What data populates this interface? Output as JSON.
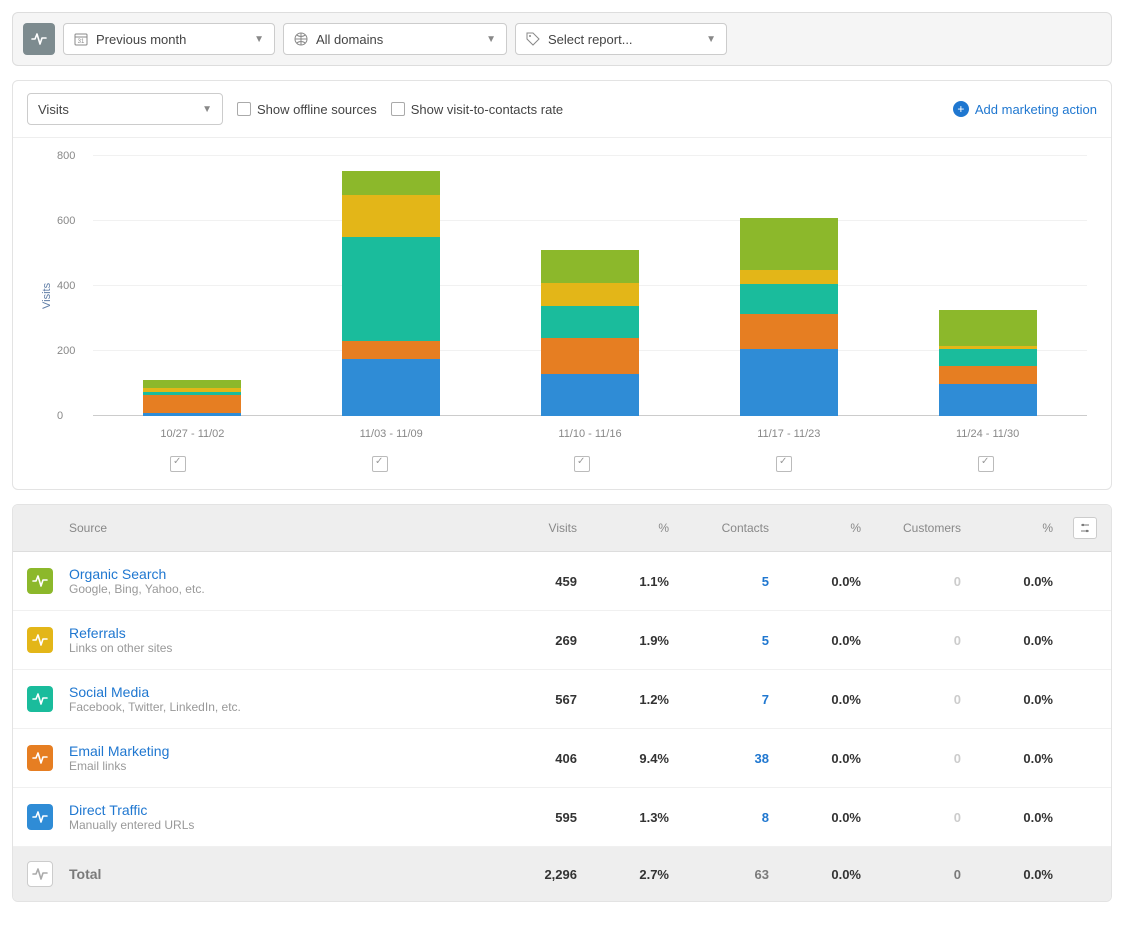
{
  "toolbar": {
    "period_label": "Previous month",
    "domain_label": "All domains",
    "report_label": "Select report..."
  },
  "controls": {
    "metric_label": "Visits",
    "show_offline_label": "Show offline sources",
    "show_rate_label": "Show visit-to-contacts rate",
    "add_action_label": "Add marketing action"
  },
  "chart_data": {
    "type": "bar",
    "ylabel": "Visits",
    "ylim": [
      0,
      800
    ],
    "y_ticks": [
      0,
      200,
      400,
      600,
      800
    ],
    "categories": [
      "10/27 - 11/02",
      "11/03 - 11/09",
      "11/10 - 11/16",
      "11/17 - 11/23",
      "11/24 - 11/30"
    ],
    "series": [
      {
        "name": "Direct Traffic",
        "color": "#2f8cd6",
        "values": [
          10,
          175,
          130,
          205,
          100
        ]
      },
      {
        "name": "Email Marketing",
        "color": "#e67e22",
        "values": [
          55,
          55,
          110,
          110,
          55
        ]
      },
      {
        "name": "Social Media",
        "color": "#1abc9c",
        "values": [
          10,
          320,
          100,
          90,
          50
        ]
      },
      {
        "name": "Referrals",
        "color": "#e3b618",
        "values": [
          10,
          130,
          70,
          45,
          10
        ]
      },
      {
        "name": "Organic Search",
        "color": "#8cb82b",
        "values": [
          25,
          75,
          100,
          160,
          110
        ]
      }
    ]
  },
  "table": {
    "headers": {
      "source": "Source",
      "visits": "Visits",
      "visits_pct": "%",
      "contacts": "Contacts",
      "contacts_pct": "%",
      "customers": "Customers",
      "customers_pct": "%"
    },
    "rows": [
      {
        "icon_color": "#8cb82b",
        "title": "Organic Search",
        "subtitle": "Google, Bing, Yahoo, etc.",
        "visits": "459",
        "visits_pct": "1.1%",
        "contacts": "5",
        "contacts_pct": "0.0%",
        "customers": "0",
        "customers_pct": "0.0%"
      },
      {
        "icon_color": "#e3b618",
        "title": "Referrals",
        "subtitle": "Links on other sites",
        "visits": "269",
        "visits_pct": "1.9%",
        "contacts": "5",
        "contacts_pct": "0.0%",
        "customers": "0",
        "customers_pct": "0.0%"
      },
      {
        "icon_color": "#1abc9c",
        "title": "Social Media",
        "subtitle": "Facebook, Twitter, LinkedIn, etc.",
        "visits": "567",
        "visits_pct": "1.2%",
        "contacts": "7",
        "contacts_pct": "0.0%",
        "customers": "0",
        "customers_pct": "0.0%"
      },
      {
        "icon_color": "#e67e22",
        "title": "Email Marketing",
        "subtitle": "Email links",
        "visits": "406",
        "visits_pct": "9.4%",
        "contacts": "38",
        "contacts_pct": "0.0%",
        "customers": "0",
        "customers_pct": "0.0%"
      },
      {
        "icon_color": "#2f8cd6",
        "title": "Direct Traffic",
        "subtitle": "Manually entered URLs",
        "visits": "595",
        "visits_pct": "1.3%",
        "contacts": "8",
        "contacts_pct": "0.0%",
        "customers": "0",
        "customers_pct": "0.0%"
      }
    ],
    "total": {
      "title": "Total",
      "visits": "2,296",
      "visits_pct": "2.7%",
      "contacts": "63",
      "contacts_pct": "0.0%",
      "customers": "0",
      "customers_pct": "0.0%"
    }
  }
}
